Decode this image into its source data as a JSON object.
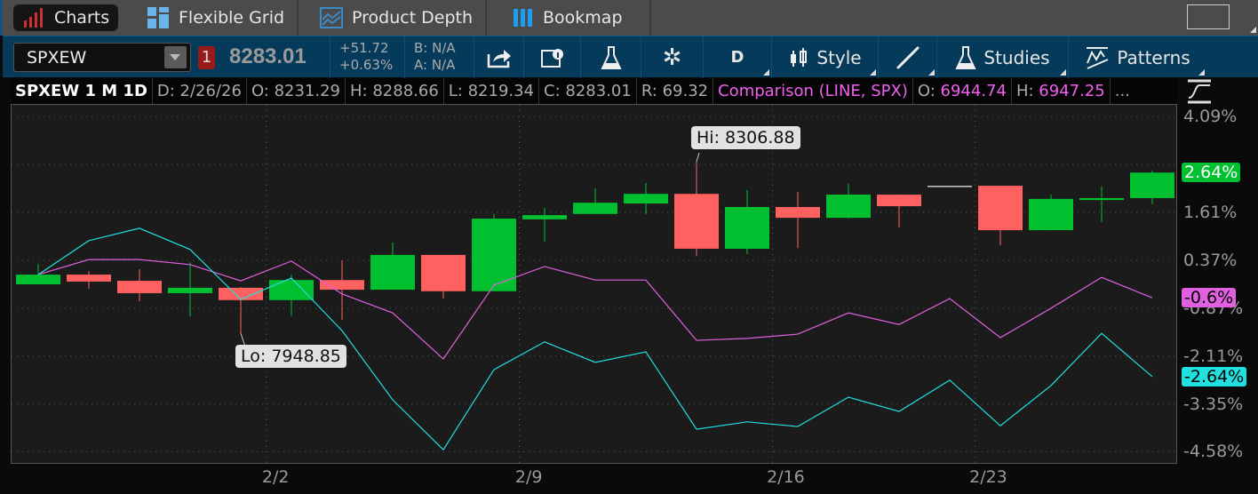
{
  "tabs": [
    {
      "label": "Charts",
      "icon": "bar-chart-icon",
      "active": true
    },
    {
      "label": "Flexible Grid",
      "icon": "grid-icon"
    },
    {
      "label": "Product Depth",
      "icon": "depth-chart-icon"
    },
    {
      "label": "Bookmap",
      "icon": "bookmap-icon"
    }
  ],
  "toolbar": {
    "symbol": "SPXEW",
    "link_badge": "1",
    "last": "8283.01",
    "change": "+51.72",
    "change_pct": "+0.63%",
    "bid": "B: N/A",
    "ask": "A: N/A",
    "aggregation": "D",
    "style": "Style",
    "studies": "Studies",
    "patterns": "Patterns"
  },
  "info": {
    "title": "SPXEW 1 M 1D",
    "date": "D: 2/26/26",
    "open": "O: 8231.29",
    "high": "H: 8288.66",
    "low": "L: 8219.34",
    "close": "C: 8283.01",
    "range": "R: 69.32",
    "comparison": "Comparison (LINE, SPX)",
    "cmp_open_label": "O: ",
    "cmp_open": "6944.74",
    "cmp_high_label": "H: ",
    "cmp_high": "6947.25",
    "more": "..."
  },
  "colors": {
    "up": "#00c030",
    "down": "#ff6060",
    "spx": "#e060e0",
    "cyan": "#20e0e0",
    "grid": "#555555"
  },
  "annotations": {
    "hi": "Hi: 8306.88",
    "lo": "Lo: 7948.85"
  },
  "chart_data": {
    "type": "candlestick",
    "y_unit": "%",
    "ylim": [
      -4.75,
      4.25
    ],
    "y_ticks": [
      "4.09%",
      "1.61%",
      "0.37%",
      "-0.87%",
      "-2.11%",
      "-3.35%",
      "-4.58%"
    ],
    "y_tick_values": [
      4.09,
      1.61,
      0.37,
      -0.87,
      -2.11,
      -3.35,
      -4.58
    ],
    "x_ticks": [
      {
        "label": "2/2",
        "index": 5
      },
      {
        "label": "2/9",
        "index": 10
      },
      {
        "label": "2/16",
        "index": 15
      },
      {
        "label": "2/23",
        "index": 19
      }
    ],
    "grid": true,
    "candles": [
      [
        -0.25,
        0.28,
        -0.25,
        0.0
      ],
      [
        0.0,
        0.09,
        -0.37,
        -0.18
      ],
      [
        -0.16,
        0.14,
        -0.69,
        -0.48
      ],
      [
        -0.48,
        0.32,
        -1.08,
        -0.34
      ],
      [
        -0.34,
        -0.32,
        -1.52,
        -0.66
      ],
      [
        -0.66,
        0.0,
        -1.06,
        -0.14
      ],
      [
        -0.14,
        0.37,
        -1.17,
        -0.39
      ],
      [
        -0.39,
        0.83,
        -0.39,
        0.51
      ],
      [
        0.51,
        0.51,
        -0.62,
        -0.43
      ],
      [
        -0.43,
        1.57,
        -0.43,
        1.45
      ],
      [
        1.43,
        1.73,
        0.85,
        1.54
      ],
      [
        1.57,
        2.23,
        1.57,
        1.86
      ],
      [
        1.84,
        2.37,
        1.57,
        2.09
      ],
      [
        2.09,
        2.92,
        0.48,
        0.67
      ],
      [
        0.67,
        2.19,
        0.53,
        1.75
      ],
      [
        1.75,
        2.14,
        0.69,
        1.47
      ],
      [
        1.47,
        2.35,
        1.45,
        2.07
      ],
      [
        2.07,
        2.07,
        1.22,
        1.77
      ],
      [
        2.3,
        2.3,
        2.3,
        2.3
      ],
      [
        2.3,
        2.3,
        0.76,
        1.15
      ],
      [
        1.15,
        2.07,
        1.15,
        1.96
      ],
      [
        1.93,
        2.28,
        1.36,
        1.98
      ],
      [
        1.98,
        2.69,
        1.82,
        2.64
      ]
    ],
    "series": [
      {
        "name": "SPX",
        "color": "#e060e0",
        "last_label": "-0.6%",
        "values": [
          0.0,
          0.39,
          0.39,
          0.26,
          -0.16,
          0.35,
          -0.5,
          -0.99,
          -2.18,
          -0.27,
          0.21,
          -0.14,
          -0.14,
          -1.7,
          -1.65,
          -1.54,
          -0.99,
          -1.29,
          -0.62,
          -1.63,
          -0.87,
          -0.07,
          -0.6
        ]
      },
      {
        "color": "#20e0e0",
        "last_label": "-2.64%",
        "values": [
          0.0,
          0.88,
          1.2,
          0.65,
          -0.64,
          -0.09,
          -1.45,
          -3.24,
          -4.53,
          -2.46,
          -1.74,
          -2.27,
          -2.0,
          -4.0,
          -3.81,
          -3.93,
          -3.17,
          -3.54,
          -2.73,
          -3.91,
          -2.87,
          -1.52,
          -2.64
        ]
      }
    ],
    "last_price_label": "2.64%"
  }
}
